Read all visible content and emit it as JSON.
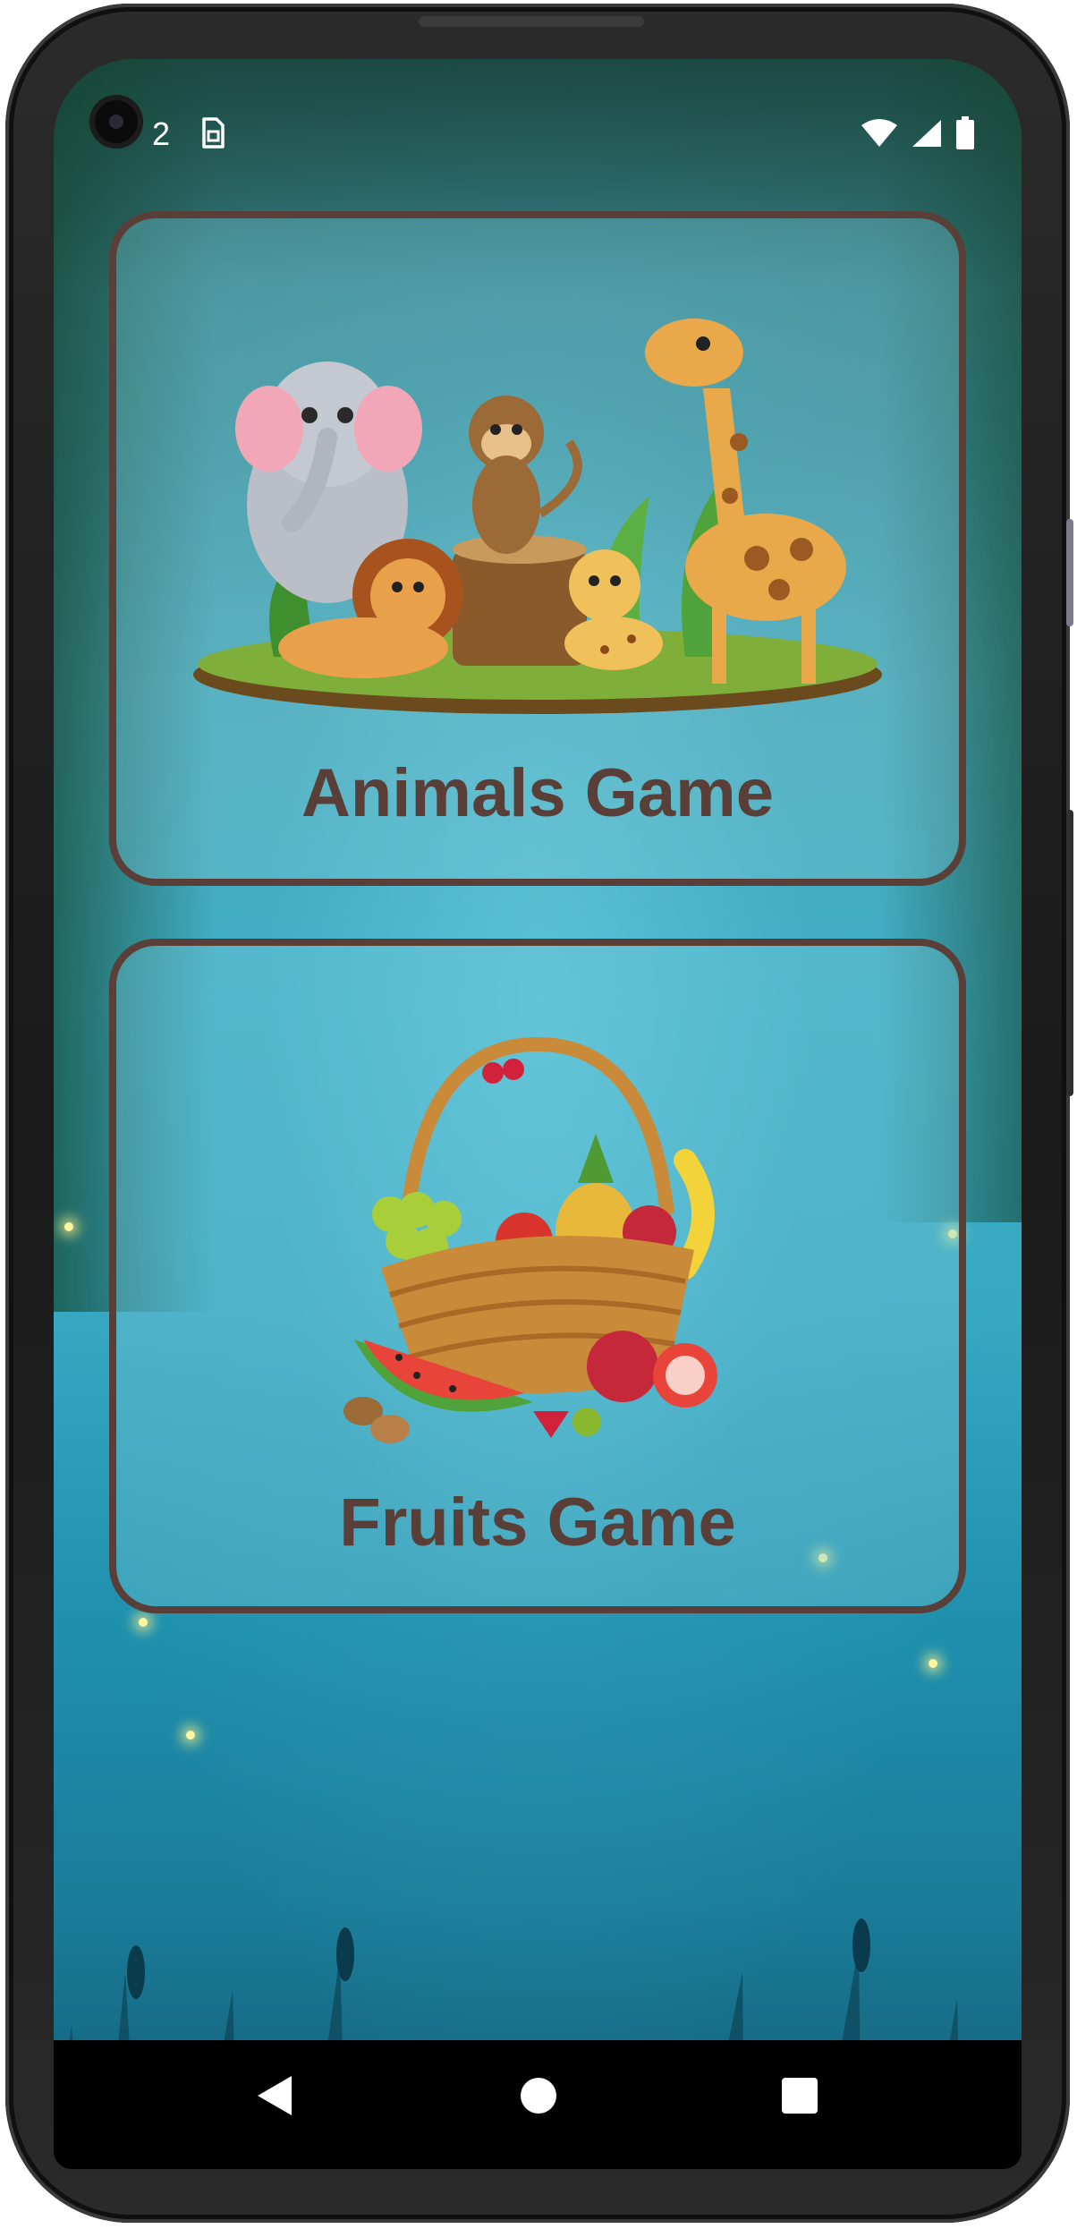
{
  "status_bar": {
    "time": "2",
    "left_icon": "sim-card-icon",
    "right_icons": [
      "wifi-icon",
      "cellular-signal-icon",
      "battery-icon"
    ]
  },
  "cards": [
    {
      "title": "Animals Game",
      "illustration": "jungle-animals-illustration"
    },
    {
      "title": "Fruits Game",
      "illustration": "fruit-basket-illustration"
    }
  ],
  "nav_bar": {
    "buttons": [
      "back-icon",
      "home-icon",
      "recents-icon"
    ]
  },
  "colors": {
    "card_border": "#5a3f38",
    "title_text": "#5a3f38",
    "background_top": "#2f6b6f",
    "background_mid": "#3fb0c8",
    "background_bottom": "#135f78"
  }
}
